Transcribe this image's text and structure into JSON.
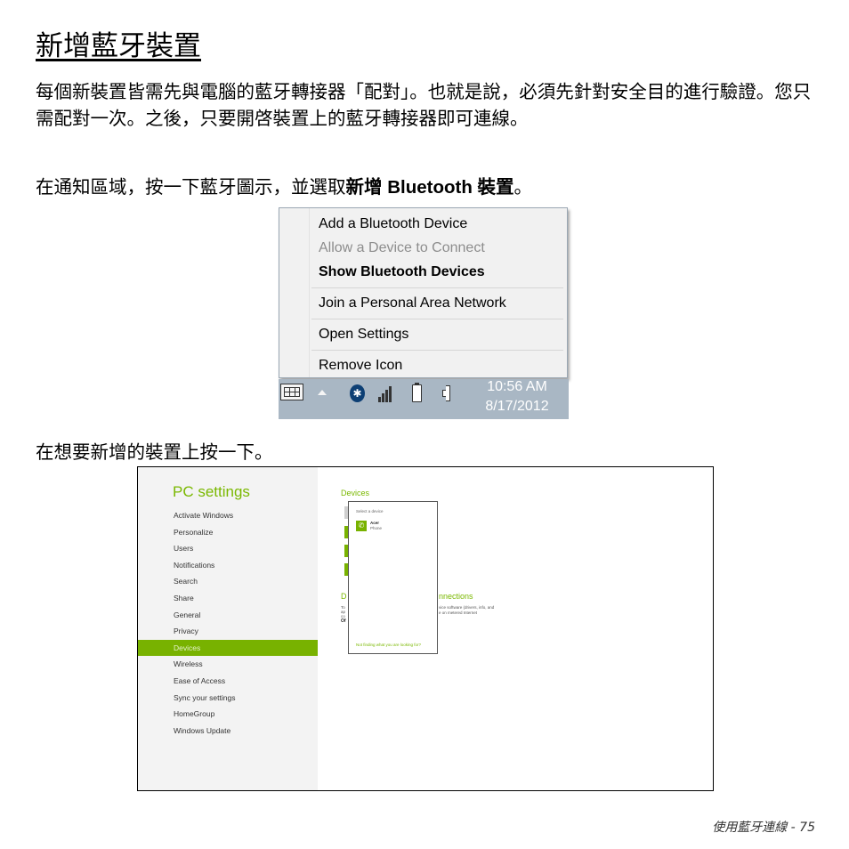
{
  "page": {
    "title": "新增藍牙裝置",
    "paragraph1": "每個新裝置皆需先與電腦的藍牙轉接器「配對」。也就是說，必須先針對安全目的進行驗證。您只需配對一次。之後，只要開啓裝置上的藍牙轉接器即可連線。",
    "paragraph2": {
      "prefix": "在通知區域，按一下藍牙圖示，並選取",
      "bold_cjk": "新增",
      "bold_latin": " Bluetooth ",
      "bold_cjk2": "裝置",
      "suffix": "。"
    },
    "paragraph3": "在想要新增的裝置上按一下。",
    "footer": {
      "chapter": "使用藍牙連線",
      "separator": " - ",
      "page_number": "75"
    }
  },
  "context_menu": {
    "items": [
      {
        "label": "Add a Bluetooth Device",
        "state": "normal"
      },
      {
        "label": "Allow a Device to Connect",
        "state": "disabled"
      },
      {
        "label": "Show Bluetooth Devices",
        "state": "default-bold"
      },
      {
        "label": "Join a Personal Area Network",
        "state": "normal"
      },
      {
        "label": "Open Settings",
        "state": "normal"
      },
      {
        "label": "Remove Icon",
        "state": "normal"
      }
    ]
  },
  "taskbar": {
    "icons": [
      "touch-keyboard-icon",
      "show-hidden-icons-arrow",
      "bluetooth-icon",
      "signal-strength-icon",
      "battery-icon",
      "speaker-icon"
    ],
    "bluetooth_glyph": "✱",
    "time": "10:56 AM",
    "date": "8/17/2012"
  },
  "pc_settings": {
    "title": "PC settings",
    "nav_items": [
      {
        "label": "Activate Windows",
        "active": false
      },
      {
        "label": "Personalize",
        "active": false
      },
      {
        "label": "Users",
        "active": false
      },
      {
        "label": "Notifications",
        "active": false
      },
      {
        "label": "Search",
        "active": false
      },
      {
        "label": "Share",
        "active": false
      },
      {
        "label": "General",
        "active": false
      },
      {
        "label": "Privacy",
        "active": false
      },
      {
        "label": "Devices",
        "active": true
      },
      {
        "label": "Wireless",
        "active": false
      },
      {
        "label": "Ease of Access",
        "active": false
      },
      {
        "label": "Sync your settings",
        "active": false
      },
      {
        "label": "HomeGroup",
        "active": false
      },
      {
        "label": "Windows Update",
        "active": false
      }
    ],
    "main_heading": "Devices",
    "section_heading_left": "D",
    "section_heading_right": "nnections",
    "section_text_left": [
      "To",
      "ap",
      "co"
    ],
    "section_text_left_bold": "Of",
    "section_text_right": [
      "vice software (drivers, info, and",
      "e on metered Internet"
    ],
    "flyout": {
      "label": "Select a device",
      "device_name": "Acer",
      "device_type": "Phone",
      "device_icon": "✆",
      "link": "Not finding what you are looking for?"
    },
    "accent_color": "#78b200"
  }
}
